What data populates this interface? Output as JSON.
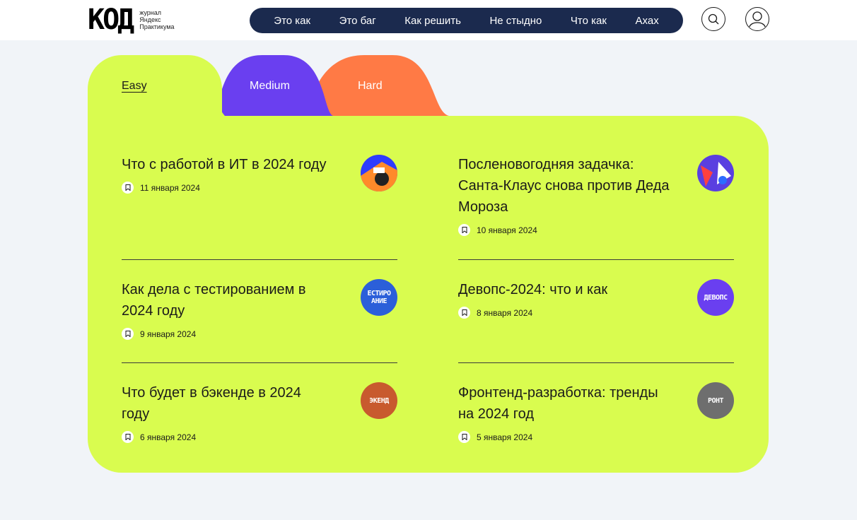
{
  "logo": {
    "word": "КОД",
    "sub": [
      "журнал",
      "Яндекс",
      "Практикума"
    ]
  },
  "nav": {
    "items": [
      {
        "label": "Это как"
      },
      {
        "label": "Это баг"
      },
      {
        "label": "Как решить"
      },
      {
        "label": "Не стыдно"
      },
      {
        "label": "Что как"
      },
      {
        "label": "Ахах"
      }
    ]
  },
  "icons": {
    "search": "search-icon",
    "profile": "profile-icon",
    "bookmark": "bookmark-icon"
  },
  "tabs": {
    "easy": {
      "label": "Easy",
      "color": "#d9fc4f",
      "active": true
    },
    "medium": {
      "label": "Medium",
      "color": "#6a3ff0"
    },
    "hard": {
      "label": "Hard",
      "color": "#ff7a45"
    }
  },
  "articles": [
    {
      "title": "Что с работой в ИТ в 2024 году",
      "date": "11 января 2024"
    },
    {
      "title": "Посленовогодняя задачка: Санта-Клаус снова против Деда Мороза",
      "date": "10 января 2024"
    },
    {
      "title": "Как дела с тестированием в 2024 году",
      "date": "9 января 2024",
      "thumb_text": "ЕСТИРО АНИЕ"
    },
    {
      "title": "Девопс-2024: что и как",
      "date": "8 января 2024",
      "thumb_text": "ДЕВОПС"
    },
    {
      "title": "Что будет в бэкенде в 2024 году",
      "date": "6 января 2024",
      "thumb_text": "ЭКЕНД"
    },
    {
      "title": "Фронтенд-разработка: тренды на 2024 год",
      "date": "5 января 2024",
      "thumb_text": "РОНТ"
    }
  ],
  "colors": {
    "panel": "#d9fc4f",
    "nav_bg": "#1b2a4e",
    "background": "#f1f4f8"
  }
}
